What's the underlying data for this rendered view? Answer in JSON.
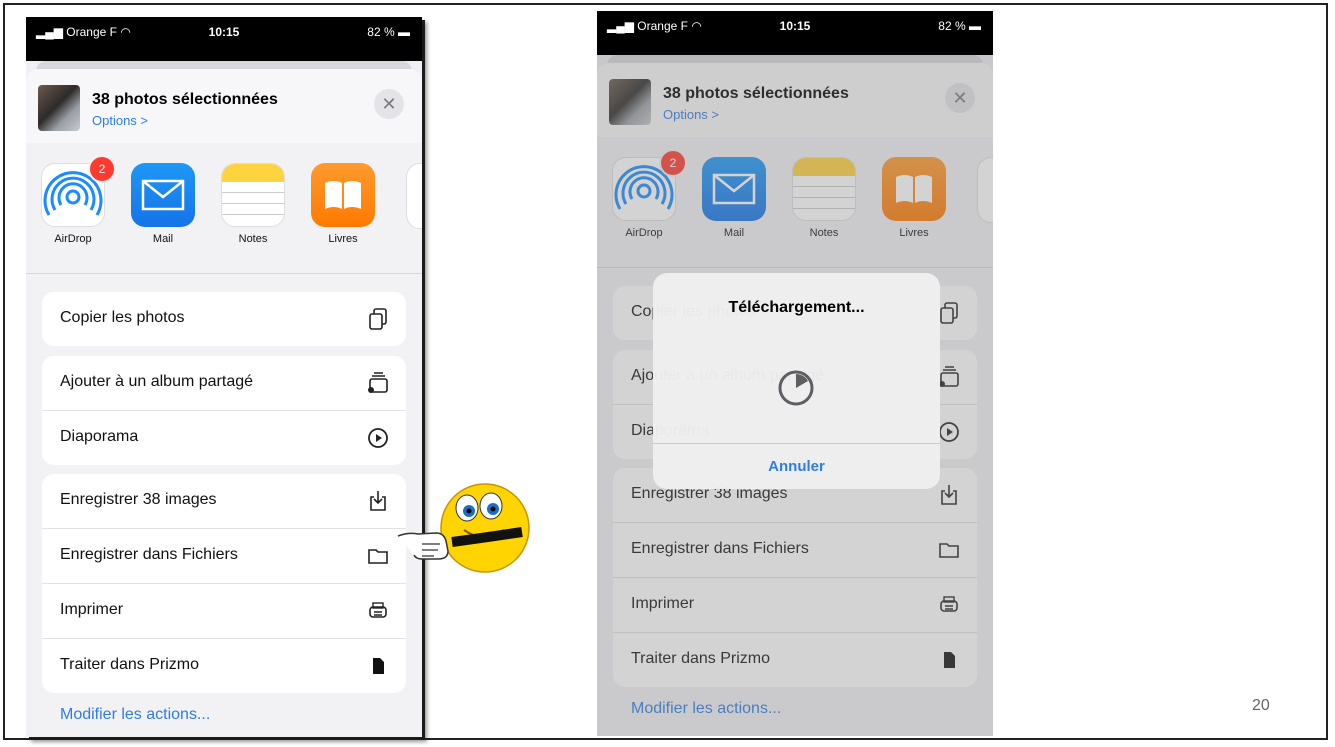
{
  "page_number": "20",
  "status": {
    "carrier": "Orange F",
    "time": "10:15",
    "battery": "82 %"
  },
  "sheet": {
    "title": "38 photos sélectionnées",
    "options": "Options >",
    "close_icon": "close-icon"
  },
  "apps": [
    {
      "label": "AirDrop",
      "badge": "2",
      "icon": "airdrop-icon"
    },
    {
      "label": "Mail",
      "icon": "mail-icon"
    },
    {
      "label": "Notes",
      "icon": "notes-icon"
    },
    {
      "label": "Livres",
      "icon": "books-icon"
    }
  ],
  "actions": {
    "copy": "Copier les photos",
    "add_album": "Ajouter à un album partagé",
    "slideshow": "Diaporama",
    "save_images": "Enregistrer 38 images",
    "save_files": "Enregistrer dans Fichiers",
    "print": "Imprimer",
    "prizmo": "Traiter dans Prizmo"
  },
  "modify_actions": "Modifier les actions...",
  "alert": {
    "title": "Téléchargement...",
    "cancel": "Annuler"
  },
  "colors": {
    "accent": "#2f7de1",
    "badge": "#ff3b30"
  }
}
